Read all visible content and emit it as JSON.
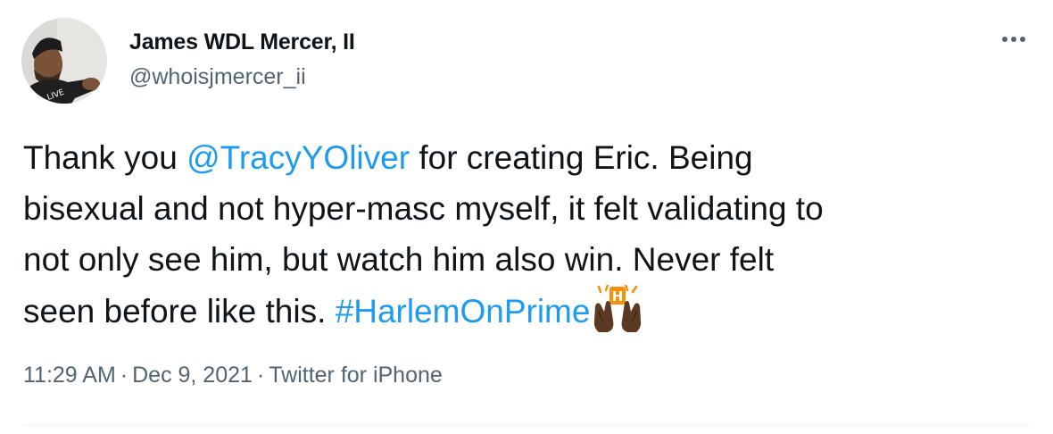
{
  "author": {
    "display_name": "James WDL Mercer, II",
    "handle": "@whoisjmercer_ii"
  },
  "tweet": {
    "lines": [
      [
        {
          "type": "text",
          "value": "Thank you "
        },
        {
          "type": "mention",
          "value": "@TracyYOliver"
        },
        {
          "type": "text",
          "value": " for creating Eric. Being"
        }
      ],
      [
        {
          "type": "text",
          "value": "bisexual and not hyper-masc myself, it felt validating to"
        }
      ],
      [
        {
          "type": "text",
          "value": "not only see him, but watch him also win. Never felt"
        }
      ],
      [
        {
          "type": "text",
          "value": "seen before like this. "
        },
        {
          "type": "hashtag",
          "value": "#HarlemOnPrime"
        }
      ]
    ],
    "emoji": "raising-hands-emoji"
  },
  "meta": {
    "time": "11:29 AM",
    "separator": "·",
    "date": "Dec 9, 2021",
    "source": "Twitter for iPhone"
  },
  "colors": {
    "link": "#1d9bf0",
    "text": "#0f1419",
    "secondary": "#536471"
  },
  "icons": {
    "more": "more-horizontal-icon"
  }
}
